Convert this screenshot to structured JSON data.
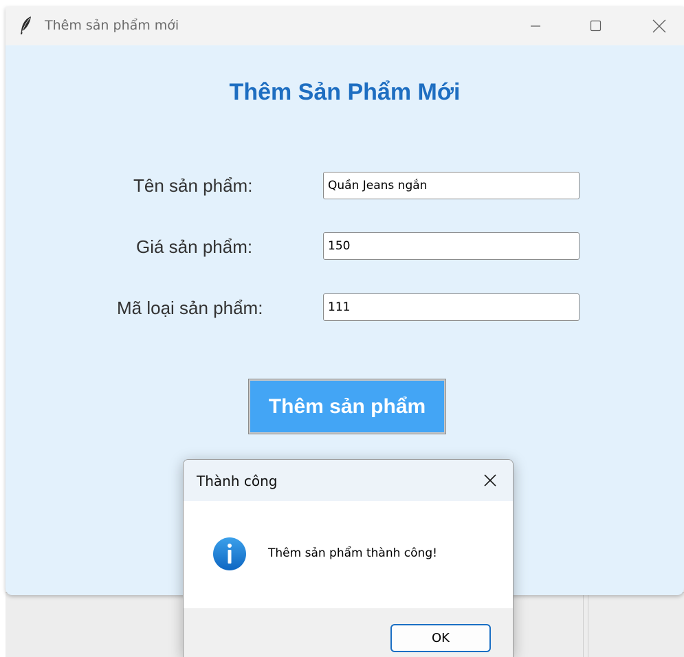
{
  "window": {
    "title": "Thêm sản phẩm mới"
  },
  "form": {
    "heading": "Thêm Sản Phẩm Mới",
    "fields": [
      {
        "label": "Tên sản phẩm:",
        "value": "Quần Jeans ngắn"
      },
      {
        "label": "Giá sản phẩm:",
        "value": "150"
      },
      {
        "label": "Mã loại sản phẩm:",
        "value": "111"
      }
    ],
    "submit_label": "Thêm sản phẩm"
  },
  "dialog": {
    "title": "Thành công",
    "message": "Thêm sản phẩm thành công!",
    "ok_label": "OK",
    "icon": "info-icon"
  },
  "colors": {
    "window_bg": "#e3f1fc",
    "heading": "#1e6ec1",
    "button_bg": "#43a5f5",
    "info_icon": "#1a78d0"
  }
}
